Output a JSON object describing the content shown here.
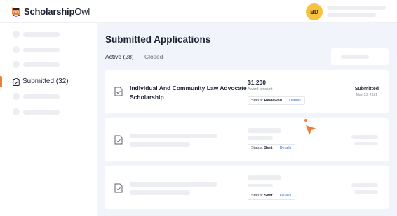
{
  "brand": {
    "name_bold": "Scholarship",
    "name_light": "Owl",
    "accent": "#f07c3a",
    "avatar_bg": "#f5c242"
  },
  "header": {
    "avatar_initials": "BD"
  },
  "sidebar": {
    "active_item": {
      "label": "Submitted (32)",
      "icon": "clipboard-check-icon"
    }
  },
  "main": {
    "title": "Submitted Applications",
    "tabs": [
      {
        "label": "Active (28)",
        "active": true
      },
      {
        "label": "Closed",
        "active": false
      }
    ]
  },
  "applications": [
    {
      "title": "Individual And Community Law Advocate Scholarship",
      "amount": "$1,200",
      "amount_label": "Award amount",
      "status_prefix": "Status:",
      "status": "Reviewed",
      "details_label": "Details",
      "state": "Submitted",
      "date": "May 13, 2021"
    },
    {
      "status_prefix": "Status:",
      "status": "Sent",
      "details_label": "Details"
    },
    {
      "status_prefix": "Status:",
      "status": "Sent",
      "details_label": "Details"
    }
  ]
}
